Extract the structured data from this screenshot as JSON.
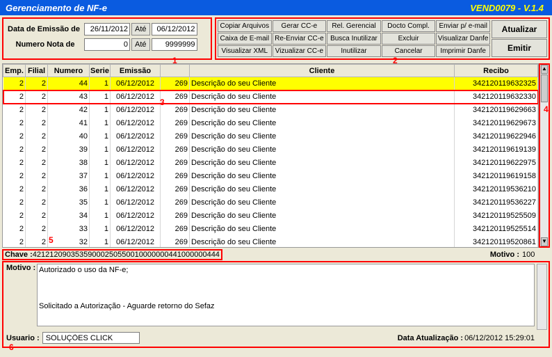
{
  "titlebar": {
    "title": "Gerenciamento de NF-e",
    "version": "VEND0079 - V.1.4"
  },
  "filter": {
    "label_emissao": "Data de Emissão de",
    "data_de": "26/11/2012",
    "ate_label": "Até",
    "data_ate": "06/12/2012",
    "label_numero": "Numero Nota de",
    "num_de": "0",
    "num_ate": "9999999"
  },
  "buttons": {
    "grid": [
      "Copiar Arquivos",
      "Gerar CC-e",
      "Rel. Gerencial",
      "Docto Compl.",
      "Enviar p/ e-mail",
      "Caixa de E-mail",
      "Re-Enviar CC-e",
      "Busca Inutilizar",
      "Excluir",
      "Visualizar Danfe",
      "Visualizar XML",
      "Vizualizar CC-e",
      "Inutilizar",
      "Cancelar",
      "Imprimir Danfe"
    ],
    "side": {
      "atualizar": "Atualizar",
      "emitir": "Emitir"
    }
  },
  "table": {
    "headers": [
      "Emp.",
      "Filial",
      "Numero",
      "Serie",
      "Emissão",
      "",
      "Cliente",
      "Recibo"
    ],
    "rows": [
      {
        "emp": "2",
        "filial": "2",
        "numero": "44",
        "serie": "1",
        "emissao": "06/12/2012",
        "cod": "269",
        "cliente": "Descrição do seu Cliente",
        "recibo": "342120119632325",
        "selected": true
      },
      {
        "emp": "2",
        "filial": "2",
        "numero": "43",
        "serie": "1",
        "emissao": "06/12/2012",
        "cod": "269",
        "cliente": "Descrição do seu Cliente",
        "recibo": "342120119632330",
        "highlighted": true
      },
      {
        "emp": "2",
        "filial": "2",
        "numero": "42",
        "serie": "1",
        "emissao": "06/12/2012",
        "cod": "269",
        "cliente": "Descrição do seu Cliente",
        "recibo": "342120119629663"
      },
      {
        "emp": "2",
        "filial": "2",
        "numero": "41",
        "serie": "1",
        "emissao": "06/12/2012",
        "cod": "269",
        "cliente": "Descrição do seu Cliente",
        "recibo": "342120119629673"
      },
      {
        "emp": "2",
        "filial": "2",
        "numero": "40",
        "serie": "1",
        "emissao": "06/12/2012",
        "cod": "269",
        "cliente": "Descrição do seu Cliente",
        "recibo": "342120119622946"
      },
      {
        "emp": "2",
        "filial": "2",
        "numero": "39",
        "serie": "1",
        "emissao": "06/12/2012",
        "cod": "269",
        "cliente": "Descrição do seu Cliente",
        "recibo": "342120119619139"
      },
      {
        "emp": "2",
        "filial": "2",
        "numero": "38",
        "serie": "1",
        "emissao": "06/12/2012",
        "cod": "269",
        "cliente": "Descrição do seu Cliente",
        "recibo": "342120119622975"
      },
      {
        "emp": "2",
        "filial": "2",
        "numero": "37",
        "serie": "1",
        "emissao": "06/12/2012",
        "cod": "269",
        "cliente": "Descrição do seu Cliente",
        "recibo": "342120119619158"
      },
      {
        "emp": "2",
        "filial": "2",
        "numero": "36",
        "serie": "1",
        "emissao": "06/12/2012",
        "cod": "269",
        "cliente": "Descrição do seu Cliente",
        "recibo": "342120119536210"
      },
      {
        "emp": "2",
        "filial": "2",
        "numero": "35",
        "serie": "1",
        "emissao": "06/12/2012",
        "cod": "269",
        "cliente": "Descrição do seu Cliente",
        "recibo": "342120119536227"
      },
      {
        "emp": "2",
        "filial": "2",
        "numero": "34",
        "serie": "1",
        "emissao": "06/12/2012",
        "cod": "269",
        "cliente": "Descrição do seu Cliente",
        "recibo": "342120119525509"
      },
      {
        "emp": "2",
        "filial": "2",
        "numero": "33",
        "serie": "1",
        "emissao": "06/12/2012",
        "cod": "269",
        "cliente": "Descrição do seu Cliente",
        "recibo": "342120119525514"
      },
      {
        "emp": "2",
        "filial": "2",
        "numero": "32",
        "serie": "1",
        "emissao": "06/12/2012",
        "cod": "269",
        "cliente": "Descrição do seu Cliente",
        "recibo": "342120119520861"
      }
    ]
  },
  "chave": {
    "label": "Chave :",
    "value": "42121209035359000250550010000000441000000444",
    "motivo_label": "Motivo :",
    "motivo_value": "100"
  },
  "bottom": {
    "motivo_label": "Motivo :",
    "msg1": "Autorizado o uso da NF-e;",
    "msg2": "Solicitado a Autorização - Aguarde retorno do Sefaz",
    "usuario_label": "Usuario :",
    "usuario_value": "SOLUÇÕES CLICK",
    "dataatu_label": "Data Atualização :",
    "dataatu_value": "06/12/2012 15:29:01"
  },
  "markers": {
    "m1": "1",
    "m2": "2",
    "m3": "3",
    "m4": "4",
    "m5": "5",
    "m6": "6"
  }
}
